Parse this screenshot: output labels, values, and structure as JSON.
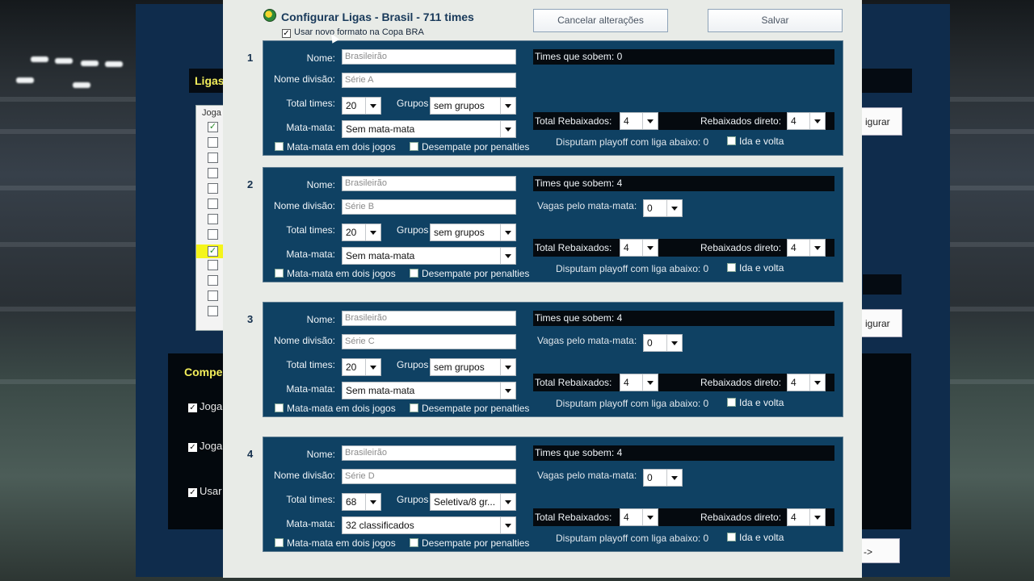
{
  "dialog": {
    "title": "Configurar Ligas - Brasil - 711 times",
    "new_format_label": "Usar novo formato na Copa BRA",
    "new_format_checked": true,
    "cancel_label": "Cancelar alterações",
    "save_label": "Salvar"
  },
  "labels": {
    "nome": "Nome:",
    "nome_divisao": "Nome divisão:",
    "total_times": "Total times:",
    "grupos": "Grupos",
    "mata_mata": "Mata-mata:",
    "mata_dois_jogos": "Mata-mata em dois jogos",
    "desempate": "Desempate por penalties",
    "total_rebaixados": "Total Rebaixados:",
    "rebaixados_direto": "Rebaixados direto:",
    "vagas_mata": "Vagas pelo mata-mata:",
    "ida_volta": "Ida e volta"
  },
  "leagues": [
    {
      "number": "1",
      "nome": "Brasileirão",
      "divisao": "Série A",
      "total_times": "20",
      "grupos": "sem grupos",
      "mata_mata": "Sem mata-mata",
      "times_sobem": "Times que sobem: 0",
      "vagas": null,
      "total_rebaixados": "4",
      "rebaixados_direto": "4",
      "playoff": "Disputam playoff com liga abaixo: 0"
    },
    {
      "number": "2",
      "nome": "Brasileirão",
      "divisao": "Série B",
      "total_times": "20",
      "grupos": "sem grupos",
      "mata_mata": "Sem mata-mata",
      "times_sobem": "Times que sobem: 4",
      "vagas": "0",
      "total_rebaixados": "4",
      "rebaixados_direto": "4",
      "playoff": "Disputam playoff com liga abaixo: 0"
    },
    {
      "number": "3",
      "nome": "Brasileirão",
      "divisao": "Série C",
      "total_times": "20",
      "grupos": "sem grupos",
      "mata_mata": "Sem mata-mata",
      "times_sobem": "Times que sobem: 4",
      "vagas": "0",
      "total_rebaixados": "4",
      "rebaixados_direto": "4",
      "playoff": "Disputam playoff com liga abaixo: 0"
    },
    {
      "number": "4",
      "nome": "Brasileirão",
      "divisao": "Série D",
      "total_times": "68",
      "grupos": "Seletiva/8 gr...",
      "mata_mata": "32 classificados",
      "times_sobem": "Times que sobem: 4",
      "vagas": "0",
      "total_rebaixados": "4",
      "rebaixados_direto": "4",
      "playoff": "Disputam playoff com liga abaixo: 0"
    }
  ],
  "background": {
    "ligas_title": "Ligas",
    "list_header": "Joga",
    "configurar_1": "igurar",
    "configurar_2": "igurar",
    "comp_title": "Compe",
    "opt_1": "Joga",
    "opt_2": "Joga",
    "opt_3": "Usar",
    "next_btn": "->"
  },
  "colors": {
    "panel_blue": "#0f4163",
    "dialog_bg": "#e8ebe7",
    "highlight_yellow": "#f5f51a"
  }
}
